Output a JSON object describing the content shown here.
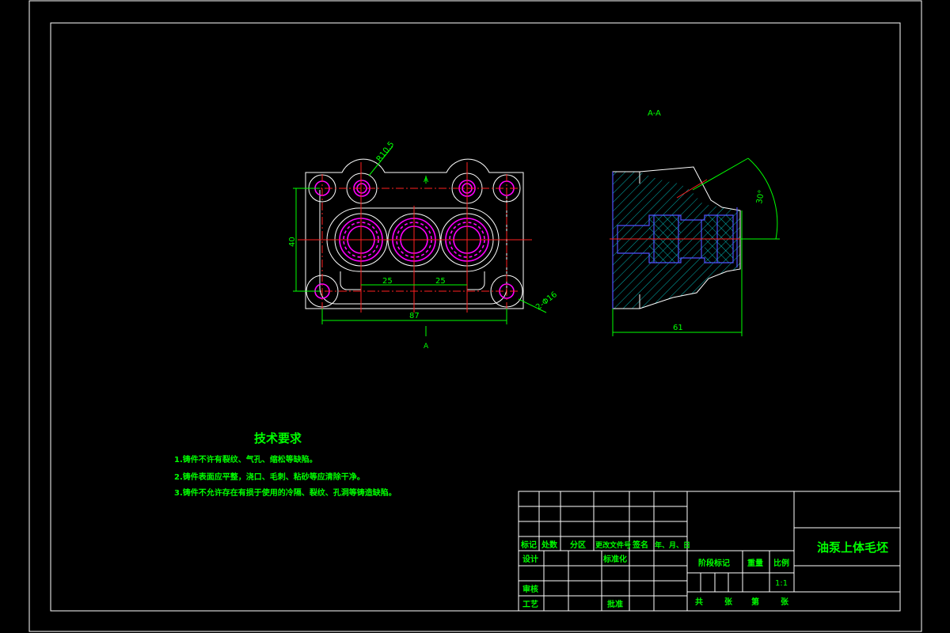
{
  "front_view": {
    "section_mark_top": "A",
    "section_mark_bottom": "A",
    "dim_radius": "R10.5",
    "dim_height": "40",
    "dim_spacing_left": "25",
    "dim_spacing_right": "25",
    "dim_overall_width": "87",
    "dim_holes": "2-Φ16"
  },
  "section_view": {
    "title": "A-A",
    "dim_angle": "30°",
    "dim_length": "61"
  },
  "technical_requirements": {
    "heading": "技术要求",
    "items": [
      "1.铸件不许有裂纹、气孔、缩松等缺陷。",
      "2.铸件表面应平整，浇口、毛刺、粘砂等应清除干净。",
      "3.铸件不允许存在有损于使用的冷隔、裂纹、孔洞等铸造缺陷。"
    ]
  },
  "title_block": {
    "col_mark": "标记",
    "col_count": "处数",
    "col_zone": "分区",
    "col_change_doc": "更改文件号",
    "col_signature": "签名",
    "col_date": "年、月、日",
    "row_design": "设计",
    "row_standard": "标准化",
    "row_review": "审核",
    "row_process": "工艺",
    "row_approve": "批准",
    "stage_mark": "阶段标记",
    "weight": "重量",
    "scale_label": "比例",
    "scale_value": "1:1",
    "part_name": "油泵上体毛坯",
    "total_label": "共",
    "sheets_label": "张",
    "page_label": "第",
    "page_sheets_label": "张"
  }
}
